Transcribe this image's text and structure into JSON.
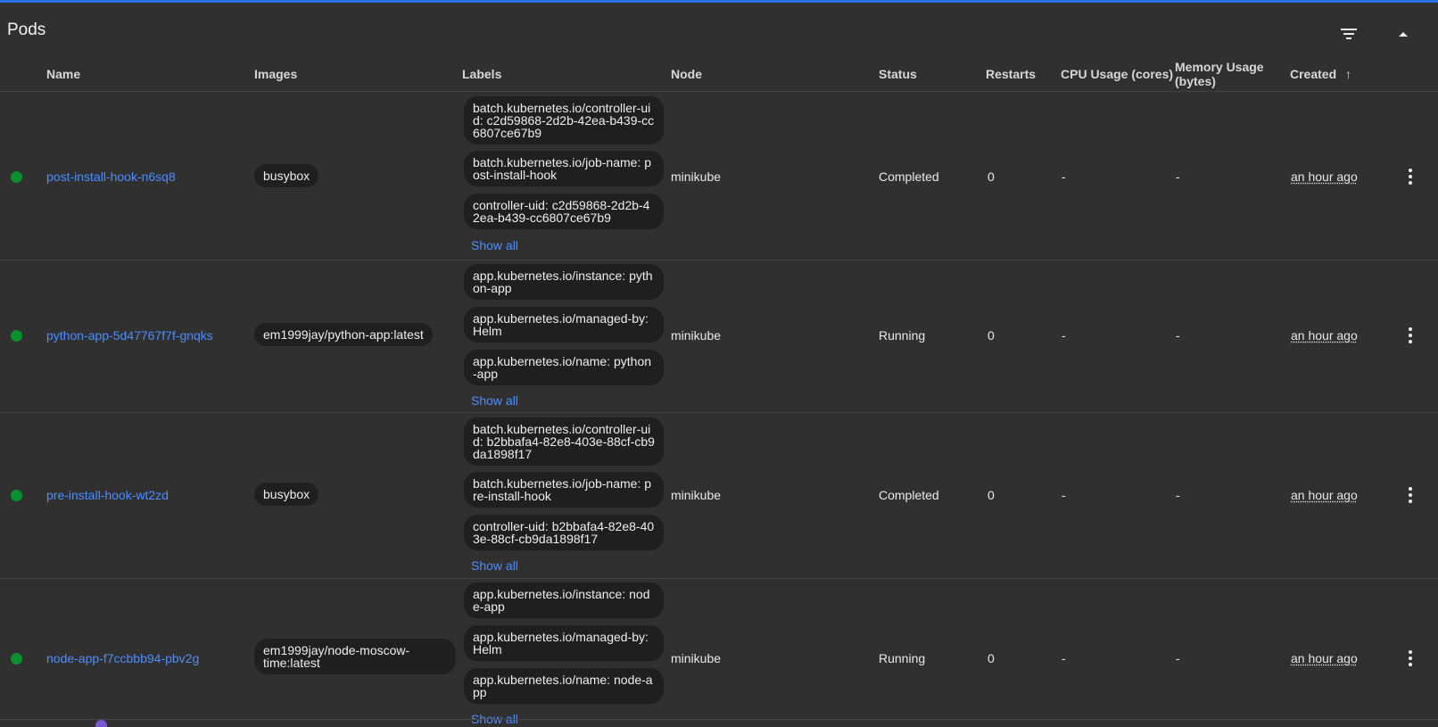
{
  "header": {
    "title": "Pods",
    "filter_icon": "filter-icon",
    "collapse_icon": "chevron-up-icon"
  },
  "columns": {
    "name": "Name",
    "images": "Images",
    "labels": "Labels",
    "node": "Node",
    "status": "Status",
    "restarts": "Restarts",
    "cpu": "CPU Usage (cores)",
    "memory_line1": "Memory Usage",
    "memory_line2": "(bytes)",
    "created": "Created",
    "sort_icon": "arrow-up-icon"
  },
  "rows": [
    {
      "name": "post-install-hook-n6sq8",
      "image": "busybox",
      "labels": [
        "batch.kubernetes.io/controller-uid: c2d59868-2d2b-42ea-b439-cc6807ce67b9",
        "batch.kubernetes.io/job-name: post-install-hook",
        "controller-uid: c2d59868-2d2b-42ea-b439-cc6807ce67b9"
      ],
      "show_all": "Show all",
      "node": "minikube",
      "status": "Completed",
      "restarts": "0",
      "cpu": "-",
      "memory": "-",
      "created": "an hour ago"
    },
    {
      "name": "python-app-5d47767f7f-gnqks",
      "image": "em1999jay/python-app:latest",
      "labels": [
        "app.kubernetes.io/instance: python-app",
        "app.kubernetes.io/managed-by: Helm",
        "app.kubernetes.io/name: python-app"
      ],
      "show_all": "Show all",
      "node": "minikube",
      "status": "Running",
      "restarts": "0",
      "cpu": "-",
      "memory": "-",
      "created": "an hour ago"
    },
    {
      "name": "pre-install-hook-wt2zd",
      "image": "busybox",
      "labels": [
        "batch.kubernetes.io/controller-uid: b2bbafa4-82e8-403e-88cf-cb9da1898f17",
        "batch.kubernetes.io/job-name: pre-install-hook",
        "controller-uid: b2bbafa4-82e8-403e-88cf-cb9da1898f17"
      ],
      "show_all": "Show all",
      "node": "minikube",
      "status": "Completed",
      "restarts": "0",
      "cpu": "-",
      "memory": "-",
      "created": "an hour ago"
    },
    {
      "name": "node-app-f7ccbbb94-pbv2g",
      "image": "em1999jay/node-moscow-time:latest",
      "labels": [
        "app.kubernetes.io/instance: node-app",
        "app.kubernetes.io/managed-by: Helm",
        "app.kubernetes.io/name: node-app"
      ],
      "show_all": "Show all",
      "node": "minikube",
      "status": "Running",
      "restarts": "0",
      "cpu": "-",
      "memory": "-",
      "created": "an hour ago"
    }
  ],
  "icons": {
    "status": "status-dot-icon",
    "row_menu": "more-vertical-icon"
  },
  "colors": {
    "accent": "#2f6fe4",
    "link": "#4c8dff",
    "running": "#0b8f2f",
    "background": "#303030"
  }
}
